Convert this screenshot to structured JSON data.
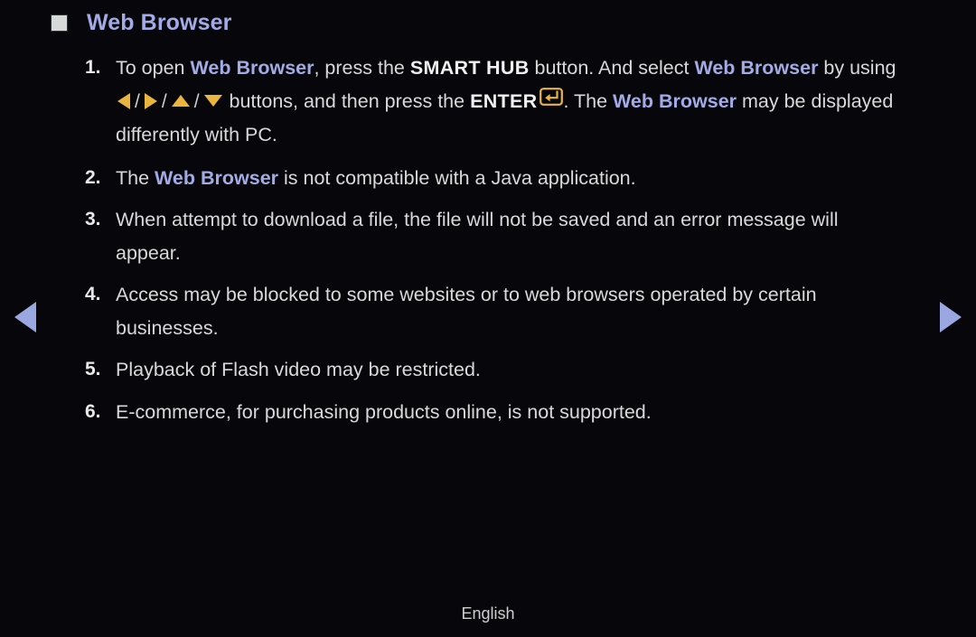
{
  "page": {
    "background_color": "#07070b",
    "body_text_color": "#d9d9d9",
    "accent_color": "#a3abe6",
    "key_glyph_color": "#eab53f"
  },
  "heading": {
    "bullet_icon": "filled-square-bullet",
    "title": "Web Browser"
  },
  "list": [
    {
      "number": "1.",
      "segments": [
        {
          "type": "text",
          "value": "To open "
        },
        {
          "type": "keyword",
          "value": "Web Browser"
        },
        {
          "type": "text",
          "value": ", press the "
        },
        {
          "type": "strong",
          "value": "SMART HUB"
        },
        {
          "type": "text",
          "value": " button. And select "
        },
        {
          "type": "keyword",
          "value": "Web Browser"
        },
        {
          "type": "text",
          "value": " by using "
        },
        {
          "type": "icon",
          "value": "arrow-left-triangle-icon"
        },
        {
          "type": "separator",
          "value": "/"
        },
        {
          "type": "icon",
          "value": "arrow-right-triangle-icon"
        },
        {
          "type": "separator",
          "value": "/"
        },
        {
          "type": "icon",
          "value": "arrow-up-triangle-icon"
        },
        {
          "type": "separator",
          "value": "/"
        },
        {
          "type": "icon",
          "value": "arrow-down-triangle-icon"
        },
        {
          "type": "text",
          "value": " buttons, and then press the "
        },
        {
          "type": "strong",
          "value": "ENTER"
        },
        {
          "type": "icon",
          "value": "enter-key-icon"
        },
        {
          "type": "text",
          "value": ". The "
        },
        {
          "type": "keyword",
          "value": "Web Browser"
        },
        {
          "type": "text",
          "value": " may be displayed differently with PC."
        }
      ]
    },
    {
      "number": "2.",
      "segments": [
        {
          "type": "text",
          "value": "The "
        },
        {
          "type": "keyword",
          "value": "Web Browser"
        },
        {
          "type": "text",
          "value": " is not compatible with a Java application."
        }
      ]
    },
    {
      "number": "3.",
      "segments": [
        {
          "type": "text",
          "value": "When attempt to download a file, the file will not be saved and an error message will appear."
        }
      ]
    },
    {
      "number": "4.",
      "segments": [
        {
          "type": "text",
          "value": "Access may be blocked to some websites or to web browsers operated by certain businesses."
        }
      ]
    },
    {
      "number": "5.",
      "segments": [
        {
          "type": "text",
          "value": "Playback of Flash video may be restricted."
        }
      ]
    },
    {
      "number": "6.",
      "segments": [
        {
          "type": "text",
          "value": "E-commerce, for purchasing products online, is not supported."
        }
      ]
    }
  ],
  "navigation": {
    "previous_icon": "nav-arrow-left-icon",
    "next_icon": "nav-arrow-right-icon"
  },
  "footer": {
    "language": "English"
  }
}
